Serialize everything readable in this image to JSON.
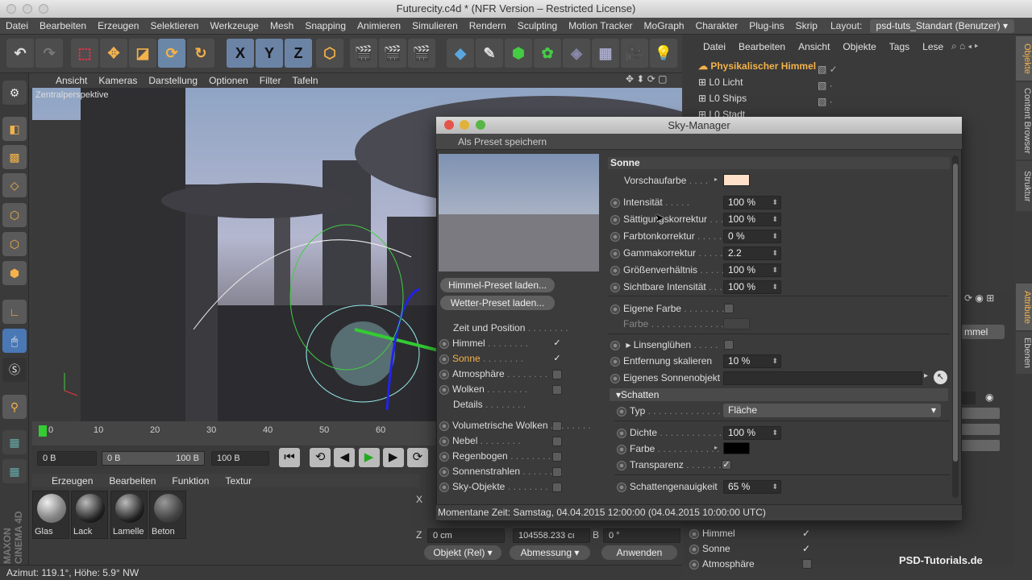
{
  "app": {
    "title": "Futurecity.c4d * (NFR Version – Restricted License)",
    "layout_label": "Layout:",
    "layout_value": "psd-tuts_Standart (Benutzer)"
  },
  "menubar": [
    "Datei",
    "Bearbeiten",
    "Erzeugen",
    "Selektieren",
    "Werkzeuge",
    "Mesh",
    "Snapping",
    "Animieren",
    "Simulieren",
    "Rendern",
    "Sculpting",
    "Motion Tracker",
    "MoGraph",
    "Charakter",
    "Plug-ins",
    "Skrip"
  ],
  "toolbar": {
    "axis_x": "X",
    "axis_y": "Y",
    "axis_z": "Z"
  },
  "viewport": {
    "menu": [
      "Ansicht",
      "Kameras",
      "Darstellung",
      "Optionen",
      "Filter",
      "Tafeln"
    ],
    "label": "Zentralperspektive"
  },
  "timeline": {
    "ticks": [
      "0",
      "10",
      "20",
      "30",
      "40",
      "50",
      "60"
    ],
    "start": "0 B",
    "range_start": "0 B",
    "range_end": "100 B",
    "end": "100 B"
  },
  "materials": {
    "menu": [
      "Erzeugen",
      "Bearbeiten",
      "Funktion",
      "Textur"
    ],
    "items": [
      "Glas",
      "Lack",
      "Lamelle",
      "Beton"
    ]
  },
  "status": "Azimut: 119.1°, Höhe: 5.9°  NW",
  "objects": {
    "menu": [
      "Datei",
      "Bearbeiten",
      "Ansicht",
      "Objekte",
      "Tags",
      "Lese"
    ],
    "items": [
      "Physikalischer Himmel",
      "Licht",
      "Ships",
      "Stadt"
    ]
  },
  "sidetabs": [
    "Objekte",
    "Content Browser",
    "Struktur",
    "Attribute",
    "Ebenen"
  ],
  "attributes": {
    "tab": "mmel",
    "items": [
      {
        "label": "Himmel",
        "checked": "✓"
      },
      {
        "label": "Sonne",
        "checked": "✓"
      },
      {
        "label": "Atmosphäre",
        "checked": ""
      }
    ]
  },
  "coords": {
    "x": "X",
    "z": "Z",
    "z_pos": "0 cm",
    "z_size": "104558.233 cı",
    "b": "B",
    "b_val": "0 °",
    "mode": "Objekt (Rel)",
    "size_mode": "Abmessung",
    "apply": "Anwenden"
  },
  "watermark": "PSD-Tutorials.de",
  "sky_manager": {
    "title": "Sky-Manager",
    "save_preset": "Als Preset speichern",
    "load_sky": "Himmel-Preset laden...",
    "load_weather": "Wetter-Preset laden...",
    "nav": [
      {
        "label": "Zeit und Position",
        "radio": false,
        "check": null,
        "active": false
      },
      {
        "label": "Himmel",
        "radio": true,
        "check": "✓",
        "active": false
      },
      {
        "label": "Sonne",
        "radio": true,
        "check": "✓",
        "active": true
      },
      {
        "label": "Atmosphäre",
        "radio": true,
        "check": "",
        "active": false
      },
      {
        "label": "Wolken",
        "radio": true,
        "check": "",
        "active": false
      },
      {
        "label": "Details",
        "radio": false,
        "check": null,
        "active": false
      },
      {
        "label": "Volumetrische Wolken",
        "radio": true,
        "check": "",
        "active": false
      },
      {
        "label": "Nebel",
        "radio": true,
        "check": "",
        "active": false
      },
      {
        "label": "Regenbogen",
        "radio": true,
        "check": "",
        "active": false
      },
      {
        "label": "Sonnenstrahlen",
        "radio": true,
        "check": "",
        "active": false
      },
      {
        "label": "Sky-Objekte",
        "radio": true,
        "check": "",
        "active": false
      }
    ],
    "section": "Sonne",
    "preview_color_label": "Vorschaufarbe",
    "preview_color": "#ffe0c8",
    "params": [
      {
        "label": "Intensität",
        "value": "100 %"
      },
      {
        "label": "Sättigungskorrektur",
        "value": "100 %"
      },
      {
        "label": "Farbtonkorrektur",
        "value": "0 %"
      },
      {
        "label": "Gammakorrektur",
        "value": "2.2"
      },
      {
        "label": "Größenverhältnis",
        "value": "100 %"
      },
      {
        "label": "Sichtbare Intensität",
        "value": "100 %"
      }
    ],
    "own_color": "Eigene Farbe",
    "color": "Farbe",
    "lens_flare": "Linsenglühen",
    "scale_distance": "Entfernung skalieren",
    "scale_distance_value": "10 %",
    "own_sun_object": "Eigenes Sonnenobjekt",
    "shadow_section": "Schatten",
    "type_label": "Typ",
    "type_value": "Fläche",
    "density_label": "Dichte",
    "density_value": "100 %",
    "shadow_color_label": "Farbe",
    "transparency_label": "Transparenz",
    "transparency_check": "✓",
    "accuracy_label": "Schattengenauigkeit",
    "accuracy_value": "65 %",
    "status": "Momentane Zeit:  Samstag, 04.04.2015   12:00:00  (04.04.2015  10:00:00 UTC)"
  }
}
